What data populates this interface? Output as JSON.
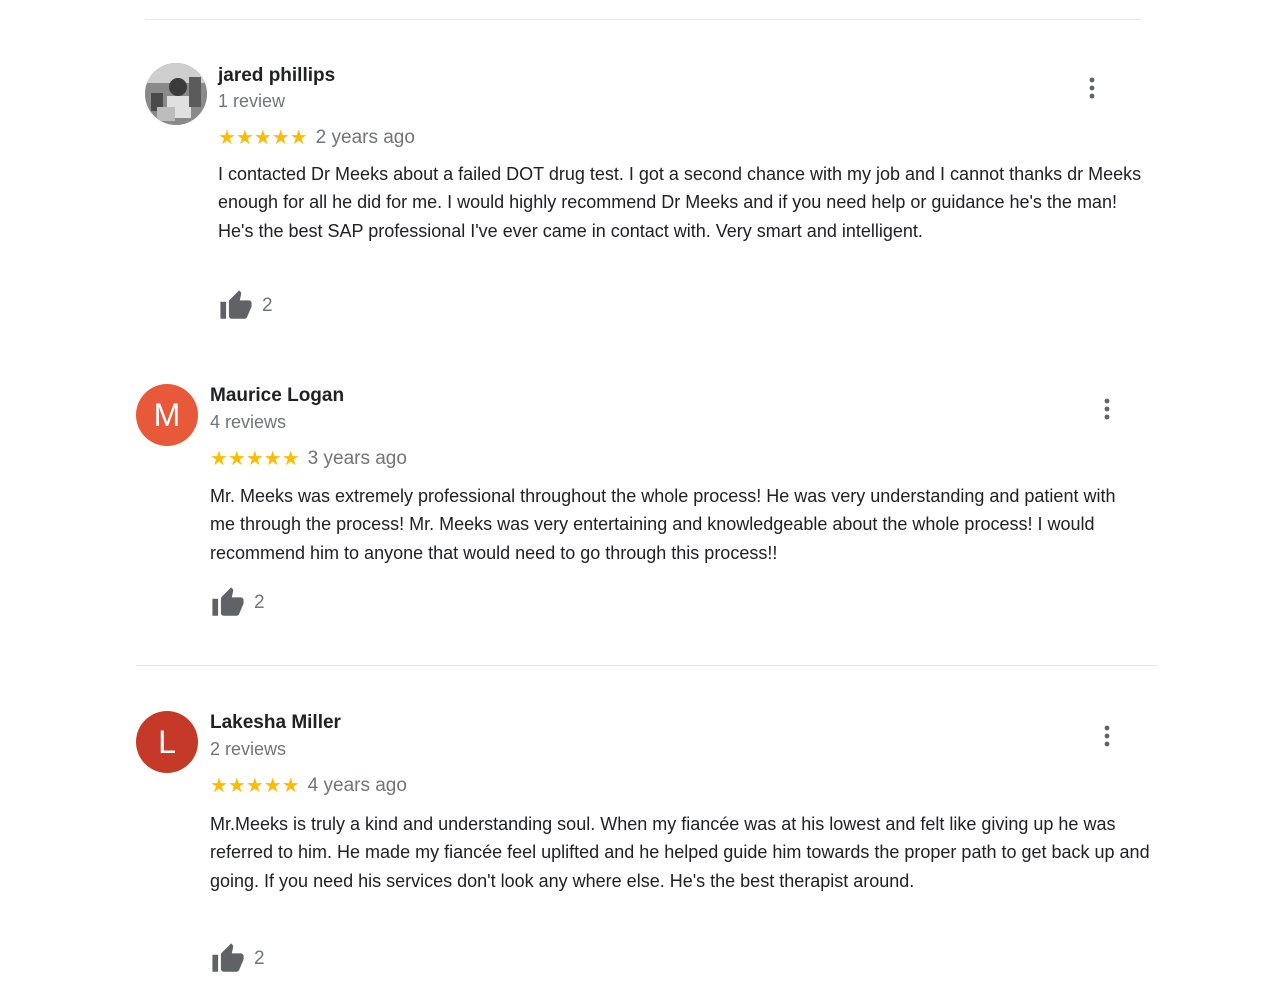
{
  "reviews": [
    {
      "author": "jared phillips",
      "review_count": "1 review",
      "stars": "★★★★★",
      "rating": 5,
      "date": "2 years ago",
      "text": "I contacted Dr Meeks about a failed DOT drug test. I got a second chance with my job and I cannot thanks dr Meeks enough for all he did for me. I would highly recommend Dr Meeks and if you need help or guidance he's the man! He's the best SAP professional I've ever came in contact with. Very smart and intelligent.",
      "likes": "2",
      "avatar_type": "photo"
    },
    {
      "author": "Maurice Logan",
      "review_count": "4 reviews",
      "stars": "★★★★★",
      "rating": 5,
      "date": "3 years ago",
      "text": "Mr. Meeks was extremely professional throughout the whole process! He was very understanding and patient with me through the process! Mr. Meeks was very entertaining and knowledgeable about the whole process! I would recommend him to anyone that would need to go through this process!!",
      "likes": "2",
      "avatar_letter": "M",
      "avatar_color": "#e8593a"
    },
    {
      "author": "Lakesha Miller",
      "review_count": "2 reviews",
      "stars": "★★★★★",
      "rating": 5,
      "date": "4 years ago",
      "text": "Mr.Meeks is truly a kind and understanding soul. When my fiancée was at his lowest and felt like giving up he was referred to him. He made my fiancée feel uplifted and he helped guide him towards the proper path to get back up and going. If you need his services don't look any where else. He's the best therapist around.",
      "likes": "2",
      "avatar_letter": "L",
      "avatar_color": "#c53929"
    }
  ],
  "colors": {
    "star": "#fbbc04",
    "secondary_text": "#70757a",
    "icon": "#5f6368"
  },
  "icons": {
    "more": "more-vert-icon",
    "like": "thumb-up-icon",
    "star": "star-icon"
  }
}
